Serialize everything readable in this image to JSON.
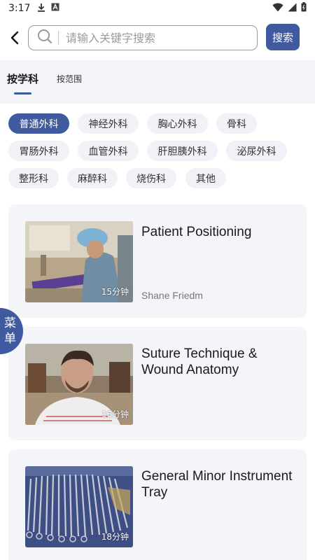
{
  "status_bar": {
    "time": "3:17",
    "icons": [
      "download-icon",
      "a-box-icon",
      "wifi-icon",
      "signal-icon",
      "battery-icon"
    ]
  },
  "search": {
    "placeholder": "请输入关键字搜索",
    "value": "",
    "button_label": "搜索"
  },
  "tabs": [
    {
      "label": "按学科",
      "active": true
    },
    {
      "label": "按范围",
      "active": false
    }
  ],
  "chips": [
    {
      "label": "普通外科",
      "active": true
    },
    {
      "label": "神经外科",
      "active": false
    },
    {
      "label": "胸心外科",
      "active": false
    },
    {
      "label": "骨科",
      "active": false
    },
    {
      "label": "胃肠外科",
      "active": false
    },
    {
      "label": "血管外科",
      "active": false
    },
    {
      "label": "肝胆胰外科",
      "active": false
    },
    {
      "label": "泌尿外科",
      "active": false
    },
    {
      "label": "整形科",
      "active": false
    },
    {
      "label": "麻醉科",
      "active": false
    },
    {
      "label": "烧伤科",
      "active": false
    },
    {
      "label": "其他",
      "active": false
    }
  ],
  "floating_menu": {
    "line1": "菜",
    "line2": "单"
  },
  "videos": [
    {
      "title": "Patient Positioning",
      "author": "Shane Friedm",
      "duration": "15分钟"
    },
    {
      "title": "Suture Technique & Wound Anatomy",
      "author": "",
      "duration": "16分钟"
    },
    {
      "title": "General Minor Instrument Tray",
      "author": "",
      "duration": "18分钟"
    }
  ],
  "colors": {
    "accent": "#3f5a9e",
    "panel_bg": "#f4f5f9",
    "chip_bg": "#f1f2f7"
  }
}
